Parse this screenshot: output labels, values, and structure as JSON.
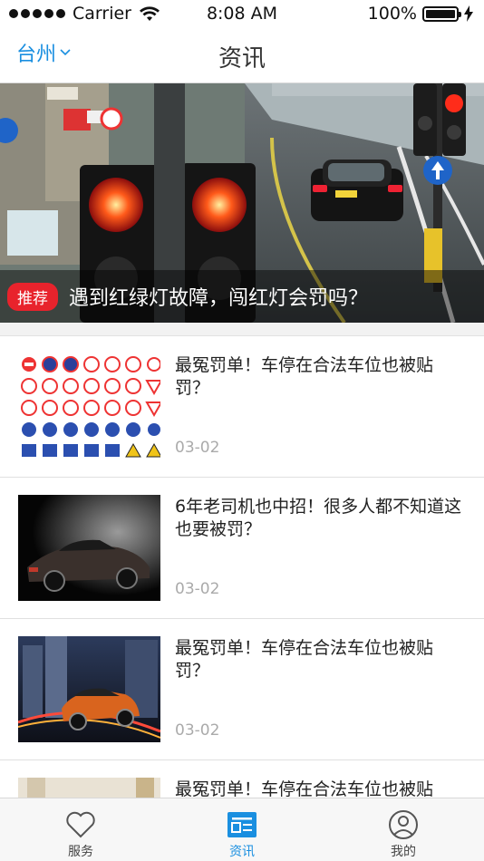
{
  "status_bar": {
    "carrier": "Carrier",
    "time": "8:08 AM",
    "battery": "100%"
  },
  "nav": {
    "city": "台州",
    "title": "资讯"
  },
  "banner": {
    "tag": "推荐",
    "title": "遇到红绿灯故障，闯红灯会罚吗？"
  },
  "news": [
    {
      "title": "最冤罚单！车停在合法车位也被贴罚？",
      "date": "03-02"
    },
    {
      "title": "6年老司机也中招！很多人都不知道这也要被罚？",
      "date": "03-02"
    },
    {
      "title": "最冤罚单！车停在合法车位也被贴罚？",
      "date": "03-02"
    },
    {
      "title": "最冤罚单！车停在合法车位也被贴罚？",
      "date": ""
    }
  ],
  "tabs": [
    {
      "label": "服务",
      "icon": "heart-icon"
    },
    {
      "label": "资讯",
      "icon": "news-icon"
    },
    {
      "label": "我的",
      "icon": "user-icon"
    }
  ],
  "colors": {
    "accent": "#1a8fe0",
    "tag_red": "#e8232c"
  }
}
